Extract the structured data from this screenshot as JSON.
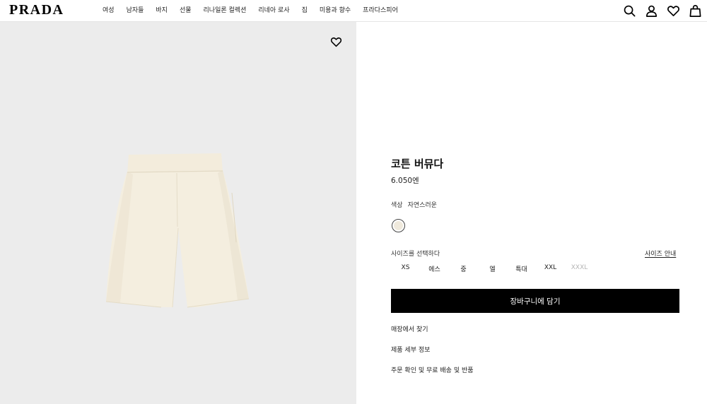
{
  "header": {
    "logo": "PRADA",
    "nav": [
      "여성",
      "남자들",
      "바지",
      "선물",
      "리나일론 컬렉션",
      "리네아 로사",
      "집",
      "미용과 향수",
      "프라다스피어"
    ],
    "icons": [
      "search-icon",
      "account-icon",
      "wishlist-icon",
      "bag-icon"
    ]
  },
  "product": {
    "title": "코튼 버뮤다",
    "price": "6.050엔",
    "color_label": "색상",
    "color_value": "자연스러운",
    "swatch_color": "#efe9dc",
    "size_label": "사이즈를 선택하다",
    "size_guide": "사이즈 안내",
    "sizes": [
      "XS",
      "에스",
      "중",
      "엘",
      "특대",
      "XXL",
      "XXXL"
    ],
    "unavailable_sizes": [
      "XXXL"
    ],
    "add_to_cart": "장바구니에 담기",
    "links": [
      "매장에서 찾기",
      "제품 세부 정보",
      "주문 확인 및 무료 배송 및 반품"
    ]
  },
  "image": {
    "background": "#ececec",
    "product_color": "#f4eedf"
  }
}
